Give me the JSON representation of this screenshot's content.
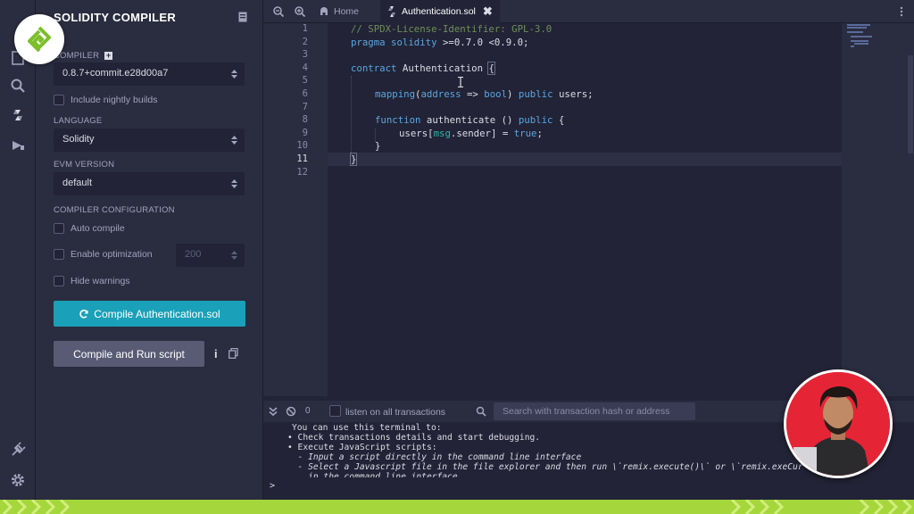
{
  "panel": {
    "title": "SOLIDITY COMPILER",
    "compiler_label": "COMPILER",
    "compiler_value": "0.8.7+commit.e28d00a7",
    "nightly_label": "Include nightly builds",
    "language_label": "LANGUAGE",
    "language_value": "Solidity",
    "evm_label": "EVM VERSION",
    "evm_value": "default",
    "config_label": "COMPILER CONFIGURATION",
    "auto_compile_label": "Auto compile",
    "optimization_label": "Enable optimization",
    "runs_value": "200",
    "hide_warnings_label": "Hide warnings",
    "compile_button": "Compile Authentication.sol",
    "run_script_button": "Compile and Run script",
    "info_icon_text": "i"
  },
  "tabs": {
    "home": "Home",
    "file": "Authentication.sol",
    "close": "✖"
  },
  "editor": {
    "line_numbers": [
      "1",
      "2",
      "3",
      "4",
      "5",
      "6",
      "7",
      "8",
      "9",
      "10",
      "11",
      "12"
    ],
    "current_line": "11",
    "lines": {
      "l1": "// SPDX-License-Identifier: GPL-3.0",
      "l2_kw": "pragma solidity",
      "l2_rest": " >=0.7.0 <0.9.0;",
      "l4_kw": "contract",
      "l4_name": " Authentication ",
      "l4_brace": "{",
      "l6_kw": "mapping",
      "l6_a": "(",
      "l6_ty1": "address",
      "l6_arrow": " => ",
      "l6_ty2": "bool",
      "l6_b": ") ",
      "l6_pub": "public",
      "l6_rest": " users;",
      "l8_kw": "function",
      "l8_rest": " authenticate () ",
      "l8_pub": "public",
      "l8_brace": " {",
      "l9_a": "users[",
      "l9_msg": "msg",
      "l9_b": ".sender] = ",
      "l9_true": "true",
      "l9_c": ";",
      "l10": "}",
      "l11": "}"
    }
  },
  "terminal": {
    "count": "0",
    "listen_label": "listen on all transactions",
    "search_placeholder": "Search with transaction hash or address",
    "lines": [
      "You can use this terminal to:",
      "• Check transactions details and start debugging.",
      "• Execute JavaScript scripts:",
      "  - Input a script directly in the command line interface",
      "  - Select a Javascript file in the file explorer and then run \\`remix.execute()\\` or \\`remix.exeCur",
      "    in the command line interface"
    ],
    "prompt": ">"
  },
  "colors": {
    "accent": "#1aa0b8",
    "banner": "#a5d63b",
    "presenter_bg": "#e52535"
  }
}
